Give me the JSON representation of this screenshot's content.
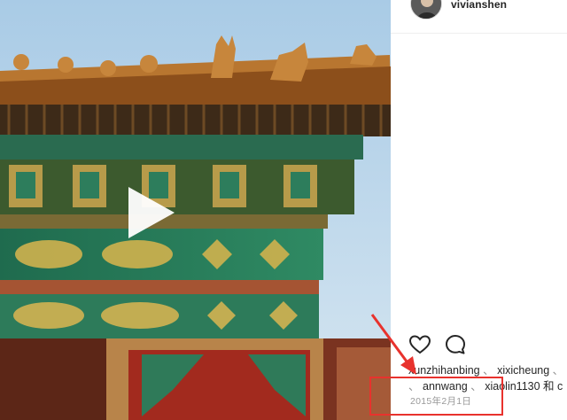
{
  "post": {
    "username": "vivianshen",
    "likes_line_1": [
      "xunzhihanbing",
      "xixicheung"
    ],
    "likes_line_2_prefix": "、",
    "likes_line_2": [
      "annwang",
      "xiaolin1130"
    ],
    "separator": "、",
    "likes_suffix": "和 c",
    "date": "2015年2月1日"
  },
  "icons": {
    "play": "play-icon",
    "like": "heart-icon",
    "comment": "comment-icon"
  },
  "colors": {
    "annotation": "#e8322d",
    "date_text": "#999999",
    "text": "#262626"
  }
}
